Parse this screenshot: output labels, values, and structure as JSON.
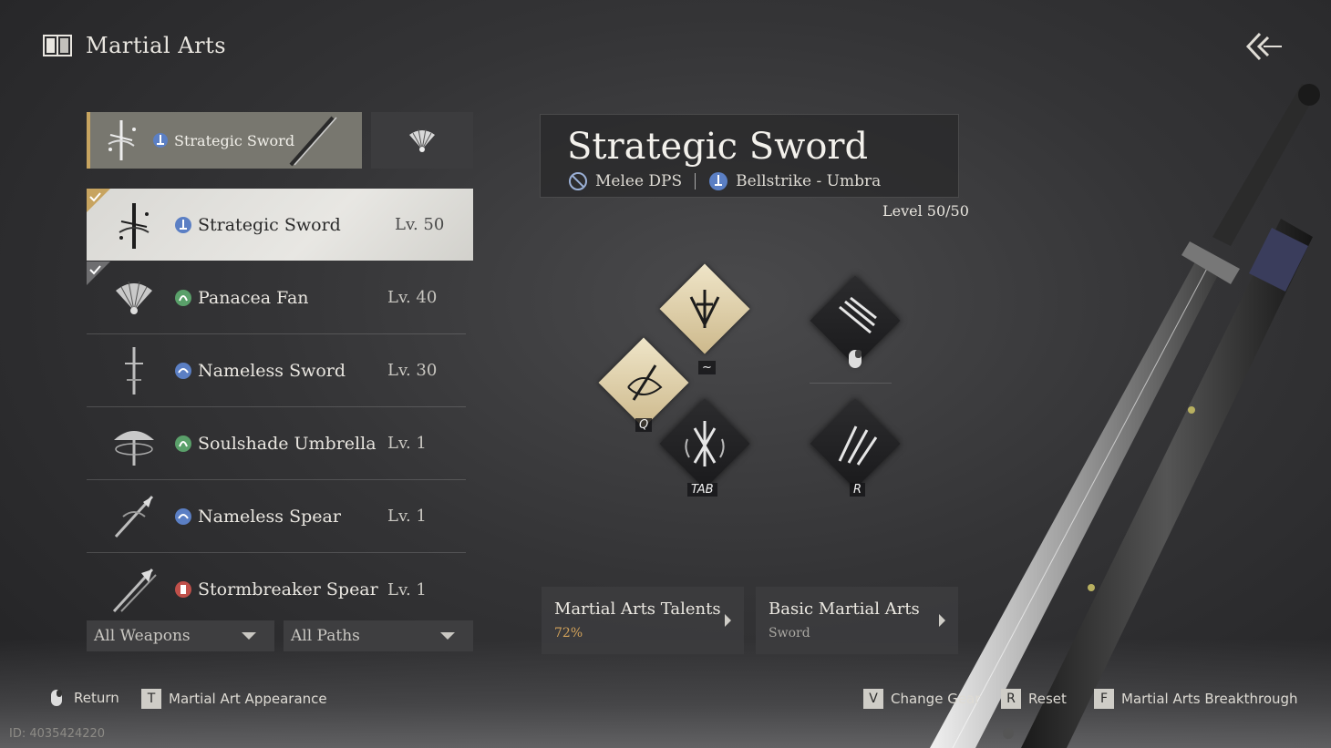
{
  "header": {
    "title": "Martial Arts"
  },
  "selected_weapon": {
    "name": "Strategic Sword"
  },
  "weapon_list": [
    {
      "name": "Strategic Sword",
      "level": "Lv. 50",
      "active": true,
      "equipped": true
    },
    {
      "name": "Panacea Fan",
      "level": "Lv. 40",
      "active": false,
      "equipped": true
    },
    {
      "name": "Nameless Sword",
      "level": "Lv. 30",
      "active": false,
      "equipped": false
    },
    {
      "name": "Soulshade Umbrella",
      "level": "Lv. 1",
      "active": false,
      "equipped": false
    },
    {
      "name": "Nameless Spear",
      "level": "Lv. 1",
      "active": false,
      "equipped": false
    },
    {
      "name": "Stormbreaker Spear",
      "level": "Lv. 1",
      "active": false,
      "equipped": false
    }
  ],
  "filters": {
    "weapons": "All Weapons",
    "paths": "All Paths"
  },
  "detail": {
    "title": "Strategic Sword",
    "role": "Melee DPS",
    "path": "Bellstrike - Umbra",
    "level": "Level 50/50"
  },
  "skills": {
    "keys": {
      "tilde": "~",
      "q": "Q",
      "tab": "TAB",
      "r": "R"
    }
  },
  "buttons": {
    "talents": {
      "title": "Martial Arts Talents",
      "value": "72%"
    },
    "basic": {
      "title": "Basic Martial Arts",
      "value": "Sword"
    }
  },
  "hints": {
    "return": "Return",
    "appearance_key": "T",
    "appearance": "Martial Art Appearance",
    "change_gear_key": "V",
    "change_gear": "Change Gear",
    "reset_key": "R",
    "reset": "Reset",
    "breakthrough_key": "F",
    "breakthrough": "Martial Arts Breakthrough"
  },
  "id_text": "ID: 4035424220",
  "colors": {
    "accent_gold": "#c7a460",
    "talent_percent": "#d2a25a",
    "path_blue": "#5b7fc4",
    "path_green": "#5aa06a",
    "path_red": "#c0504a"
  }
}
